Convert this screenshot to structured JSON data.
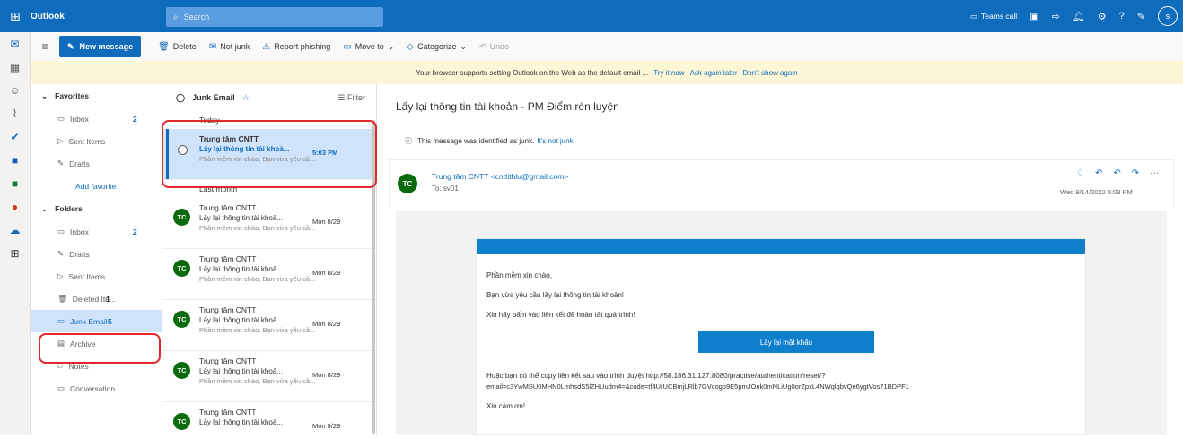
{
  "app": {
    "name": "Outlook"
  },
  "search": {
    "placeholder": "Search"
  },
  "topbar": {
    "teams_call": "Teams call"
  },
  "user": {
    "initial": "s"
  },
  "toolbar": {
    "new_message": "New message",
    "delete": "Delete",
    "not_junk": "Not junk",
    "report_phishing": "Report phishing",
    "move_to": "Move to",
    "categorize": "Categorize",
    "undo": "Undo",
    "more": "···"
  },
  "infobar": {
    "text": "Your browser supports setting Outlook on the Web as the default email ...",
    "try_it": "Try it now",
    "ask_later": "Ask again later",
    "dont_show": "Don't show again"
  },
  "favorites": {
    "header": "Favorites",
    "items": [
      {
        "label": "Inbox",
        "count": "2"
      },
      {
        "label": "Sent Items",
        "count": ""
      },
      {
        "label": "Drafts",
        "count": ""
      }
    ],
    "add_favorite": "Add favorite"
  },
  "folders": {
    "header": "Folders",
    "items": [
      {
        "label": "Inbox",
        "count": "2"
      },
      {
        "label": "Drafts",
        "count": ""
      },
      {
        "label": "Sent Items",
        "count": ""
      },
      {
        "label": "Deleted Ite...",
        "count": "1"
      },
      {
        "label": "Junk Email",
        "count": "5"
      },
      {
        "label": "Archive",
        "count": ""
      },
      {
        "label": "Notes",
        "count": ""
      },
      {
        "label": "Conversation ...",
        "count": ""
      }
    ]
  },
  "list": {
    "title": "Junk Email",
    "filter": "Filter",
    "group_today": "Today",
    "group_last_month": "Last month",
    "selected": {
      "sender": "Trung tâm CNTT",
      "subject": "Lấy lại thông tin tài khoả...",
      "preview": "Phần mềm xin chào, Bạn vừa yêu cầ...",
      "date": "5:03 PM"
    },
    "messages": [
      {
        "avatar": "TC",
        "sender": "Trung tâm CNTT",
        "subject": "Lấy lại thông tin tài khoả...",
        "preview": "Phần mềm xin chào, Bạn vừa yêu cầ...",
        "date": "Mon 8/29"
      },
      {
        "avatar": "TC",
        "sender": "Trung tâm CNTT",
        "subject": "Lấy lại thông tin tài khoả...",
        "preview": "Phần mềm xin chào, Bạn vừa yêu cầ...",
        "date": "Mon 8/29"
      },
      {
        "avatar": "TC",
        "sender": "Trung tâm CNTT",
        "subject": "Lấy lại thông tin tài khoả...",
        "preview": "Phần mềm xin chào, Bạn vừa yêu cầ...",
        "date": "Mon 8/29"
      },
      {
        "avatar": "TC",
        "sender": "Trung tâm CNTT",
        "subject": "Lấy lại thông tin tài khoả...",
        "preview": "Phần mềm xin chào, Bạn vừa yêu cầ...",
        "date": "Mon 8/29"
      },
      {
        "avatar": "TC",
        "sender": "Trung tâm CNTT",
        "subject": "Lấy lại thông tin tài khoả...",
        "preview": "",
        "date": "Mon 8/29"
      }
    ]
  },
  "reading": {
    "title": "Lấy lại thông tin tài khoản - PM Điểm rèn luyện",
    "junk_note": "This message was identified as junk.",
    "not_junk_link": "It's not junk",
    "sender_initials": "TC",
    "sender": "Trung tâm CNTT <cnttithlu@gmail.com>",
    "to": "To: sv01",
    "date": "Wed 9/14/2022 5:03 PM",
    "body": {
      "greeting": "Phần mềm xin chào,",
      "line1": "Bạn vừa yêu cầu lấy lại thông tin tài khoản!",
      "line2": "Xin hãy bấm vào liên kết để hoàn tất quá trình!",
      "button": "Lấy lại mật khẩu",
      "copy_hint": "Hoặc bạn có thể copy liên kết sau vào trình duyệt http://58.186.31.127:8080/practise/authentication/reset/?",
      "link": "email=c3YwMSU0MHN0LmhsdS5lZHUudm4=&code=tf4UrUCBmjLRlb7GVcogo9E5pmJOnk0mNLiUg0orZpxL4NWqlqbvQe6ygtVos71BDPF1",
      "thanks": "Xin cảm ơn!"
    }
  },
  "colors": {
    "accent": "#0f6cbd",
    "highlight": "#e0282b",
    "avatar": "#0b6a0b"
  }
}
